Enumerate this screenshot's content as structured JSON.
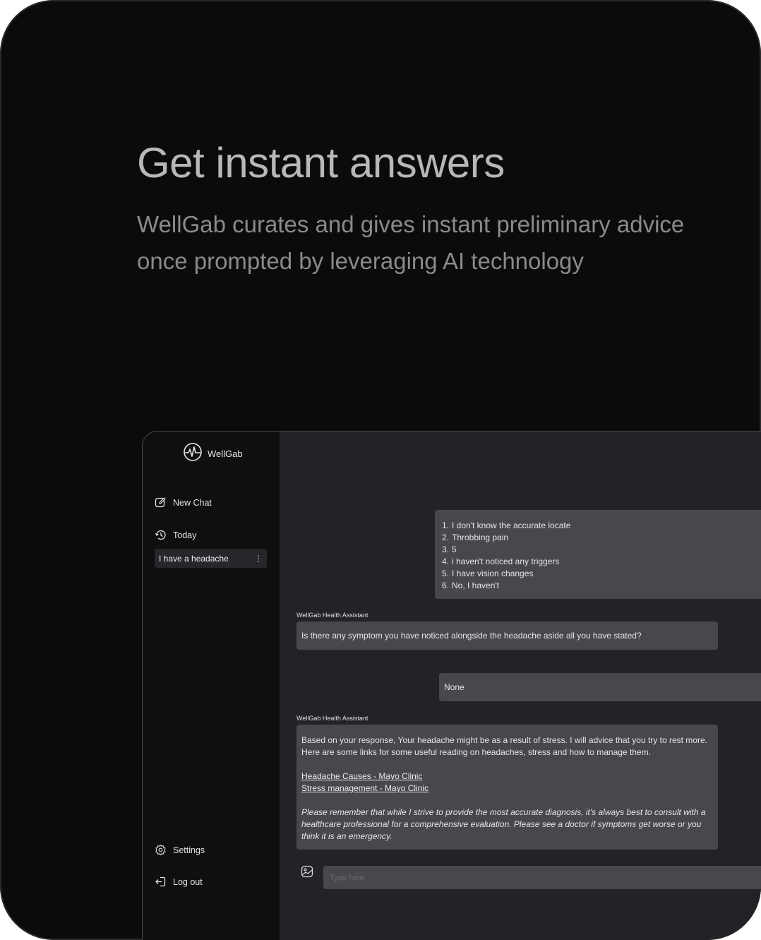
{
  "hero": {
    "title": "Get instant answers",
    "subtitle": "WellGab curates and gives instant preliminary advice once prompted by leveraging AI technology"
  },
  "app": {
    "logo_text": "WellGab",
    "sidebar": {
      "new_chat": "New Chat",
      "section_today": "Today",
      "chats": [
        {
          "title": "I have a headache"
        }
      ],
      "settings": "Settings",
      "logout": "Log out"
    },
    "conversation": {
      "user_message_1": [
        {
          "n": "1.",
          "text": "I don't know the accurate locate"
        },
        {
          "n": "2.",
          "text": "Throbbing pain"
        },
        {
          "n": "3.",
          "text": "5"
        },
        {
          "n": "4.",
          "text": "i haven't noticed any triggers"
        },
        {
          "n": "5.",
          "text": "I have vision changes"
        },
        {
          "n": "6.",
          "text": "No, I haven't"
        }
      ],
      "assistant_label": "WellGab Health Assistant",
      "assistant_message_1": "Is there any symptom you have noticed alongside the headache aside all you have stated?",
      "user_message_2": "None",
      "assistant_message_2": {
        "intro": "Based on your response, Your headache might be as a result of stress. I will advice that you try to rest more. Here are some links for some useful reading on headaches, stress and how to manage them.",
        "links": [
          "Headache Causes - Mayo Clinic",
          "Stress management - Mayo Clinic"
        ],
        "disclaimer": "Please remember that while I strive to provide the most accurate diagnosis, it's always best to consult with a healthcare professional for a comprehensive evaluation. Please see a doctor if symptoms get worse or you think it is an emergency."
      }
    },
    "composer": {
      "placeholder": "Type here"
    }
  }
}
